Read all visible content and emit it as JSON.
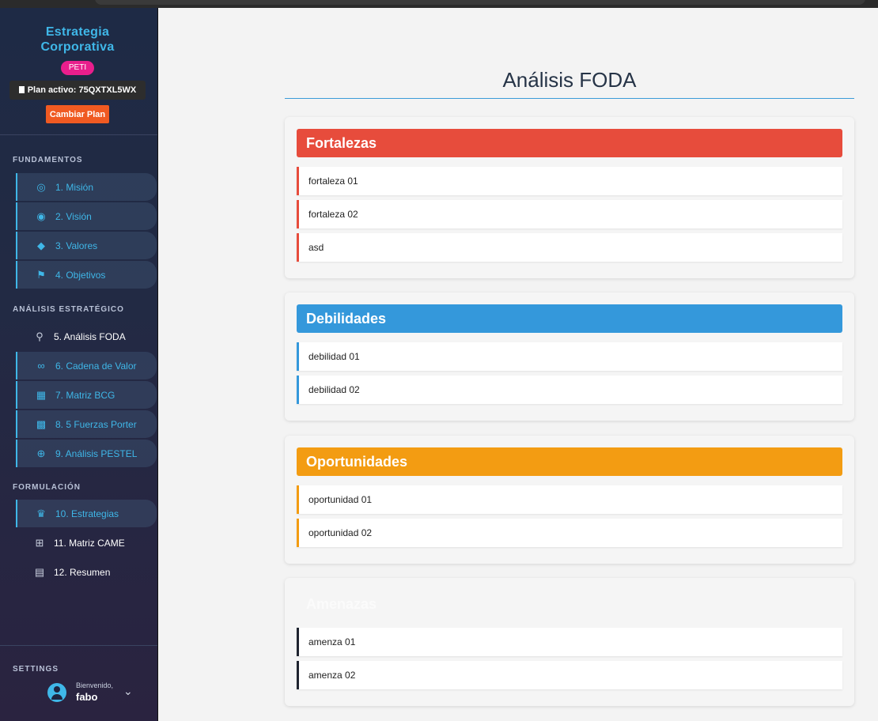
{
  "sidebar": {
    "brand_line1": "Estrategia",
    "brand_line2": "Corporativa",
    "badge": "PETI",
    "plan_label": "Plan activo: 75QXTXL5WX",
    "change_plan": "Cambiar Plan",
    "sections": {
      "fundamentos": "FUNDAMENTOS",
      "analisis": "ANÁLISIS ESTRATÉGICO",
      "formulacion": "FORMULACIÓN",
      "settings": "SETTINGS"
    },
    "items": [
      {
        "label": "1. Misión",
        "icon": "target-icon"
      },
      {
        "label": "2. Visión",
        "icon": "eye-icon"
      },
      {
        "label": "3. Valores",
        "icon": "gem-icon"
      },
      {
        "label": "4. Objetivos",
        "icon": "flag-checkered-icon"
      },
      {
        "label": "5. Análisis FODA",
        "icon": "search-icon"
      },
      {
        "label": "6. Cadena de Valor",
        "icon": "link-icon"
      },
      {
        "label": "7. Matriz BCG",
        "icon": "grid-icon"
      },
      {
        "label": "8. 5 Fuerzas Porter",
        "icon": "chess-board-icon"
      },
      {
        "label": "9. Análisis PESTEL",
        "icon": "globe-icon"
      },
      {
        "label": "10. Estrategias",
        "icon": "chess-queen-icon"
      },
      {
        "label": "11. Matriz CAME",
        "icon": "table-icon"
      },
      {
        "label": "12. Resumen",
        "icon": "file-icon"
      }
    ],
    "user": {
      "welcome": "Bienvenido,",
      "name": "fabo"
    }
  },
  "main": {
    "title": "Análisis FODA",
    "colors": {
      "fortalezas": "#e74c3c",
      "debilidades": "#3498db",
      "oportunidades": "#f39c12",
      "amenazas": "#1f2430"
    },
    "fortalezas": {
      "title": "Fortalezas",
      "items": [
        "fortaleza 01",
        "fortaleza 02",
        "asd"
      ]
    },
    "debilidades": {
      "title": "Debilidades",
      "items": [
        "debilidad 01",
        "debilidad 02"
      ]
    },
    "oportunidades": {
      "title": "Oportunidades",
      "items": [
        "oportunidad 01",
        "oportunidad 02"
      ]
    },
    "amenazas": {
      "title": "Amenazas",
      "items": [
        "amenza 01",
        "amenza 02"
      ]
    }
  }
}
